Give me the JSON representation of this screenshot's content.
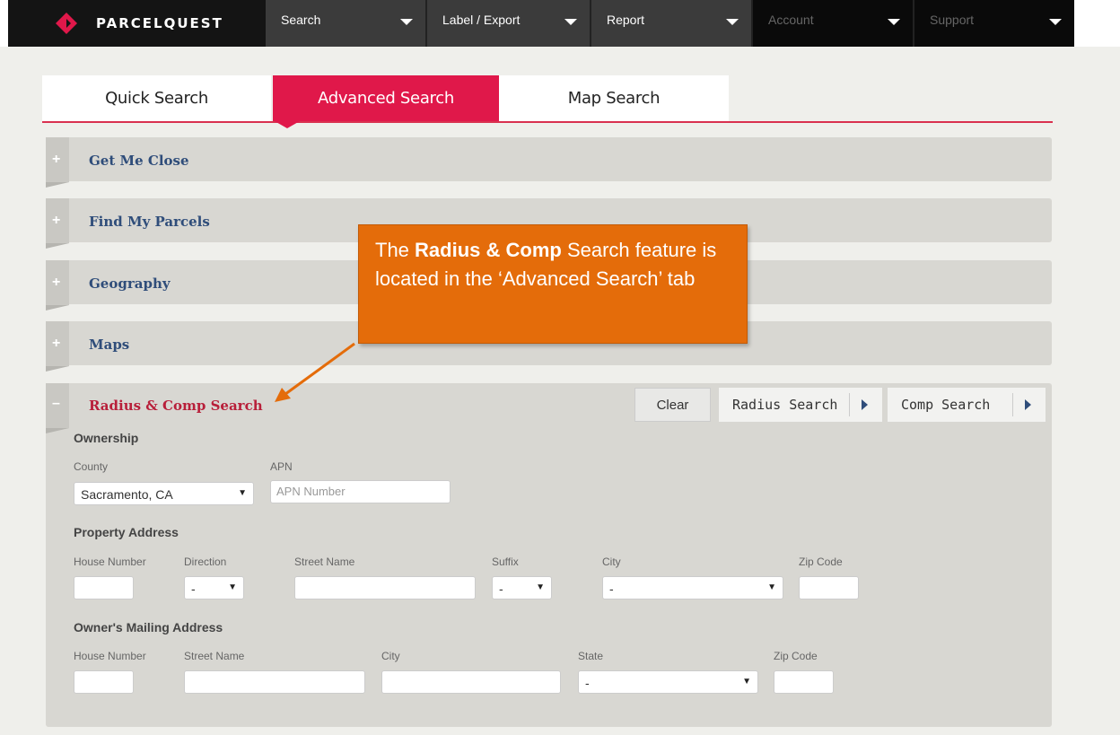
{
  "app": {
    "brand": "PARCELQUEST",
    "accent": "#e0184a"
  },
  "nav": {
    "items": [
      {
        "label": "Search",
        "icon": "chevron-down-icon"
      },
      {
        "label": "Label / Export",
        "icon": "chevron-down-icon"
      },
      {
        "label": "Report",
        "icon": "chevron-down-icon"
      },
      {
        "label": "Account",
        "icon": "chevron-down-icon"
      },
      {
        "label": "Support",
        "icon": "chevron-down-icon"
      }
    ]
  },
  "tabs": [
    {
      "label": "Quick Search",
      "active": false
    },
    {
      "label": "Advanced Search",
      "active": true
    },
    {
      "label": "Map Search",
      "active": false
    }
  ],
  "sections": [
    {
      "title": "Get Me Close",
      "expanded": false
    },
    {
      "title": "Find My Parcels",
      "expanded": false
    },
    {
      "title": "Geography",
      "expanded": false
    },
    {
      "title": "Maps",
      "expanded": false
    },
    {
      "title": "Radius & Comp Search",
      "expanded": true
    }
  ],
  "radius_section": {
    "buttons": {
      "clear": "Clear",
      "radius": "Radius Search",
      "comp": "Comp Search"
    },
    "ownership": {
      "title": "Ownership",
      "county_label": "County",
      "county_value": "Sacramento, CA",
      "apn_label": "APN",
      "apn_placeholder": "APN Number"
    },
    "property_address": {
      "title": "Property Address",
      "house_number": "House Number",
      "direction": "Direction",
      "direction_value": "-",
      "street_name": "Street Name",
      "suffix": "Suffix",
      "suffix_value": "-",
      "city": "City",
      "city_value": "-",
      "zip": "Zip Code"
    },
    "mailing_address": {
      "title": "Owner's Mailing Address",
      "house_number": "House Number",
      "street_name": "Street Name",
      "city": "City",
      "state": "State",
      "state_value": "-",
      "zip": "Zip Code"
    }
  },
  "callout": {
    "pre": "The ",
    "bold": "Radius & Comp",
    "post": " Search feature is located in the ‘Advanced Search’ tab",
    "color": "#e46c0a"
  }
}
